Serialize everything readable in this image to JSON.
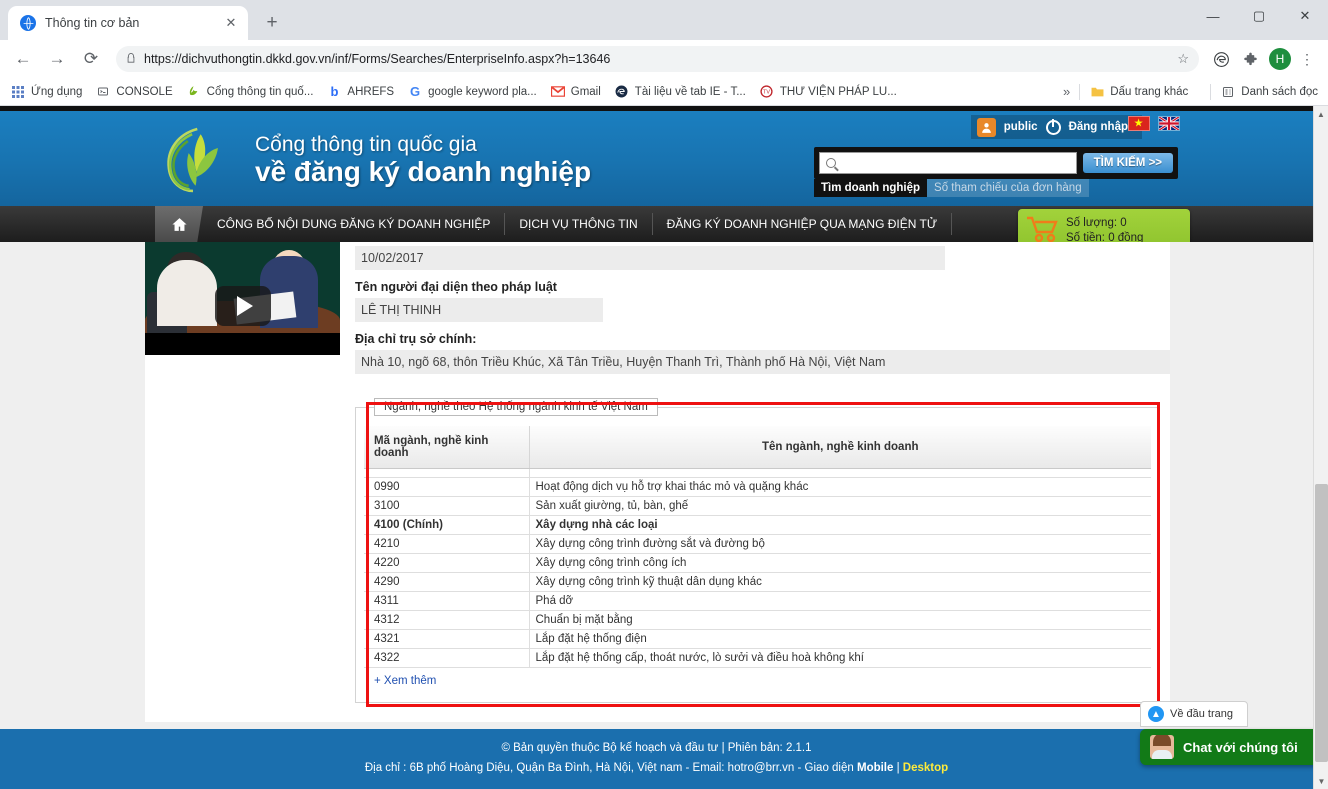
{
  "browser": {
    "tab": {
      "title": "Thông tin cơ bản",
      "favicon": "globe-icon",
      "close": "✕"
    },
    "newtab_label": "+",
    "window": {
      "minimize": "—",
      "maximize": "▢",
      "close": "✕"
    },
    "nav": {
      "back": "←",
      "forward": "→",
      "reload": "⟳"
    },
    "omnibox": {
      "lock": "🔒",
      "url": "https://dichvuthongtin.dkkd.gov.vn/inf/Forms/Searches/EnterpriseInfo.aspx?h=13646",
      "star": "☆"
    },
    "toolbar_icons": [
      "edge-icon",
      "extensions-puzzle-icon"
    ],
    "profile_initial": "H",
    "menu": "⋮",
    "bookmarks": [
      {
        "label": "Ứng dụng",
        "icon": "apps-grid-icon"
      },
      {
        "label": "CONSOLE",
        "icon": "console-icon"
      },
      {
        "label": "Cổng thông tin quố...",
        "icon": "leaf-icon"
      },
      {
        "label": "AHREFS",
        "icon": "ahrefs-icon"
      },
      {
        "label": "google keyword pla...",
        "icon": "google-icon"
      },
      {
        "label": "Gmail",
        "icon": "gmail-icon"
      },
      {
        "label": "Tài liệu về tab IE - T...",
        "icon": "edge-icon"
      },
      {
        "label": "THƯ VIỆN PHÁP LU...",
        "icon": "seal-icon"
      }
    ],
    "bookmarks_overflow": "»",
    "bookmarks_right": [
      {
        "label": "Dấu trang khác",
        "icon": "folder-icon"
      },
      {
        "label": "Danh sách đọc",
        "icon": "reading-list-icon"
      }
    ]
  },
  "site": {
    "brand": {
      "line1": "Cổng thông tin quốc gia",
      "line2": "về đăng ký doanh nghiệp",
      "logo": "leaf-logo"
    },
    "account": {
      "user_icon": "user-avatar-icon",
      "user": "public",
      "power_icon": "power-icon",
      "login": "Đăng nhập"
    },
    "languages": [
      {
        "name": "vietnam-flag",
        "label": "VN"
      },
      {
        "name": "uk-flag",
        "label": "EN"
      }
    ],
    "search": {
      "placeholder": "",
      "value": "",
      "icon": "search-icon",
      "button": "TÌM KIẾM >>",
      "tabs": [
        {
          "label": "Tìm doanh nghiệp",
          "active": true
        },
        {
          "label": "Số tham chiếu của đơn hàng",
          "active": false
        }
      ]
    },
    "nav": {
      "home_icon": "home-icon",
      "items": [
        "CÔNG BỐ NỘI DUNG ĐĂNG KÝ DOANH NGHIỆP",
        "DỊCH VỤ THÔNG TIN",
        "ĐĂNG KÝ DOANH NGHIỆP QUA MẠNG ĐIỆN TỬ"
      ]
    },
    "cart": {
      "icon": "shopping-cart-icon",
      "quantity": "Số lượng: 0",
      "amount": "Số tiền: 0 đồng"
    }
  },
  "main": {
    "video": {
      "name": "intro-video-thumbnail",
      "play_icon": "play-button-icon"
    },
    "date_value": "10/02/2017",
    "rep_label": "Tên người đại diện theo pháp luật",
    "rep_value": "LÊ THỊ THINH",
    "addr_label": "Địa chỉ trụ sở chính:",
    "addr_value": "Nhà 10, ngõ 68, thôn Triều Khúc, Xã Tân Triều, Huyện Thanh Trì, Thành phố Hà Nội, Việt Nam",
    "industry": {
      "legend": "Ngành, nghề theo Hệ thống ngành kinh tế Việt Nam",
      "columns": [
        "Mã ngành, nghề kinh doanh",
        "Tên ngành, nghề kinh doanh"
      ],
      "rows": [
        {
          "code": "0990",
          "name": "Hoạt động dịch vụ hỗ trợ khai thác mỏ và quặng khác",
          "main": false
        },
        {
          "code": "3100",
          "name": "Sản xuất giường, tủ, bàn, ghế",
          "main": false
        },
        {
          "code": "4100 (Chính)",
          "name": "Xây dựng nhà các loại",
          "main": true
        },
        {
          "code": "4210",
          "name": "Xây dựng công trình đường sắt và đường bộ",
          "main": false
        },
        {
          "code": "4220",
          "name": "Xây dựng công trình công ích",
          "main": false
        },
        {
          "code": "4290",
          "name": "Xây dựng công trình kỹ thuật dân dụng khác",
          "main": false
        },
        {
          "code": "4311",
          "name": "Phá dỡ",
          "main": false
        },
        {
          "code": "4312",
          "name": "Chuẩn bị mặt bằng",
          "main": false
        },
        {
          "code": "4321",
          "name": "Lắp đặt hệ thống điện",
          "main": false
        },
        {
          "code": "4322",
          "name": "Lắp đặt hệ thống cấp, thoát nước, lò sưởi và điều hoà không khí",
          "main": false
        }
      ],
      "more_link": "+ Xem thêm",
      "highlight_color": "#ee1111"
    }
  },
  "footer": {
    "line1": "© Bản quyền thuộc Bộ kế hoạch và đầu tư | Phiên bản: 2.1.1",
    "line2_pre": "Địa chỉ : 6B phố Hoàng Diệu, Quận Ba Đình, Hà Nội, Việt nam - Email: hotro@brr.vn - Giao diện ",
    "line2_mobile": "Mobile",
    "line2_sep": " | ",
    "line2_desktop": "Desktop"
  },
  "widgets": {
    "back_to_top": {
      "label": "Về đầu trang",
      "icon": "arrow-up-circle-icon"
    },
    "chat": {
      "label": "Chat với chúng tôi",
      "icon": "support-agent-icon"
    }
  },
  "colors": {
    "site_blue": "#1b7fc0",
    "footer_blue": "#1b6fae",
    "cart_green": "#8cc22c",
    "chat_green": "#127a17",
    "highlight_red": "#ee1111",
    "link_blue": "#1f4fb0"
  }
}
